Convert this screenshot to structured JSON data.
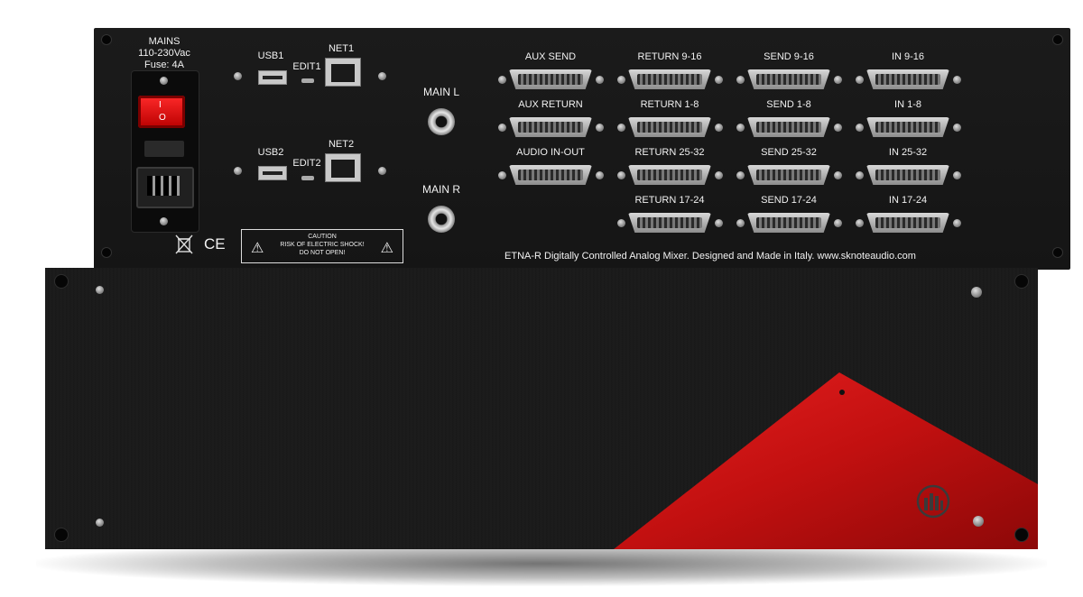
{
  "rear_panel": {
    "mains": {
      "line1": "MAINS",
      "line2": "110-230Vac",
      "line3": "Fuse: 4A"
    },
    "switch": {
      "top": "I",
      "bottom": "O"
    },
    "usb1": "USB1",
    "edit1": "EDIT1",
    "net1": "NET1",
    "usb2": "USB2",
    "edit2": "EDIT2",
    "net2": "NET2",
    "main_l": "MAIN L",
    "main_r": "MAIN R",
    "ce_mark": "CE",
    "caution": {
      "line1": "CAUTION",
      "line2": "RISK OF ELECTRIC SHOCK!",
      "line3": "DO NOT OPEN!"
    },
    "connectors": [
      {
        "label": "AUX SEND"
      },
      {
        "label": "RETURN 9-16"
      },
      {
        "label": "SEND 9-16"
      },
      {
        "label": "IN 9-16"
      },
      {
        "label": "AUX RETURN"
      },
      {
        "label": "RETURN 1-8"
      },
      {
        "label": "SEND 1-8"
      },
      {
        "label": "IN 1-8"
      },
      {
        "label": "AUDIO IN-OUT"
      },
      {
        "label": "RETURN 25-32"
      },
      {
        "label": "SEND 25-32"
      },
      {
        "label": "IN 25-32"
      },
      {
        "label": "RETURN 17-24"
      },
      {
        "label": "SEND 17-24"
      },
      {
        "label": "IN 17-24"
      }
    ],
    "footer": "ETNA-R Digitally Controlled Analog Mixer. Designed and Made in Italy. www.sknoteaudio.com"
  },
  "colors": {
    "panel": "#161616",
    "accent_red": "#d01010",
    "switch_red": "#e80000"
  },
  "icons": [
    "weee-bin-icon",
    "ce-mark-icon",
    "warning-triangle-icon",
    "sknote-logo-icon"
  ]
}
